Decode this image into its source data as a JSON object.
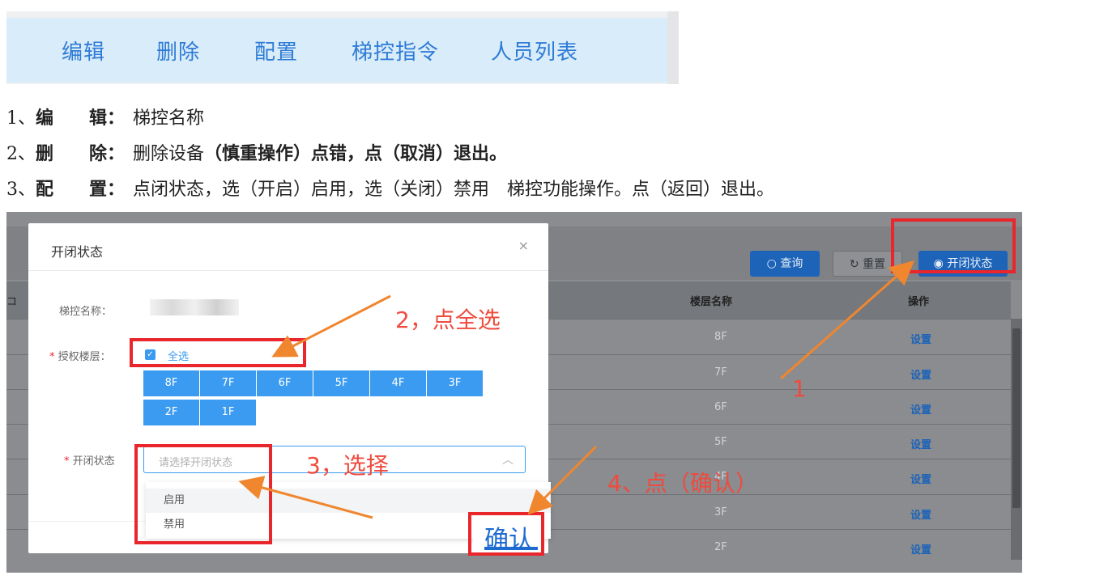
{
  "tabs": {
    "edit": "编辑",
    "delete": "删除",
    "config": "配置",
    "elevator_cmd": "梯控指令",
    "person_list": "人员列表"
  },
  "doc": {
    "line1": {
      "num": "1、",
      "key_a": "编",
      "key_b": "辑：",
      "desc": "梯控名称"
    },
    "line2": {
      "num": "2、",
      "key_a": "删",
      "key_b": "除：",
      "desc_a": "删除设备",
      "desc_b": "（慎重操作）点错，点（取消）退出。"
    },
    "line3": {
      "num": "3、",
      "key_a": "配",
      "key_b": "置：",
      "desc": "点闭状态，选（开启）启用，选（关闭）禁用　梯控功能操作。点（返回）退出。"
    }
  },
  "screen": {
    "toolbar": {
      "query": "查询",
      "reset": "重置",
      "toggle_state": "开闭状态"
    },
    "table": {
      "columns": {
        "floor_name": "楼层名称",
        "action": "操作"
      },
      "rows": [
        {
          "floor": "8F",
          "action": "设置"
        },
        {
          "floor": "7F",
          "action": "设置"
        },
        {
          "floor": "6F",
          "action": "设置"
        },
        {
          "floor": "5F",
          "action": "设置"
        },
        {
          "floor": "4F",
          "action": "设置"
        },
        {
          "floor": "3F",
          "action": "设置"
        },
        {
          "floor": "2F",
          "action": "设置"
        }
      ]
    },
    "modal": {
      "title": "开闭状态",
      "close": "×",
      "name_label": "梯控名称：",
      "floors_label": "授权楼层：",
      "select_all": "全选",
      "floors": [
        "8F",
        "7F",
        "6F",
        "5F",
        "4F",
        "3F",
        "2F",
        "1F"
      ],
      "state_label": "开闭状态",
      "state_placeholder": "请选择开闭状态",
      "options": [
        "启用",
        "禁用"
      ],
      "confirm": "确认"
    }
  },
  "annotations": {
    "step1": "1",
    "step2": "2，点全选",
    "step3": "3，选择",
    "step4": "4、点（确认）"
  },
  "colors": {
    "annotation": "#e8262b",
    "accent": "#1d63b8",
    "floor_chip": "#3b9bf0",
    "tab_text": "#2e7bd6"
  }
}
